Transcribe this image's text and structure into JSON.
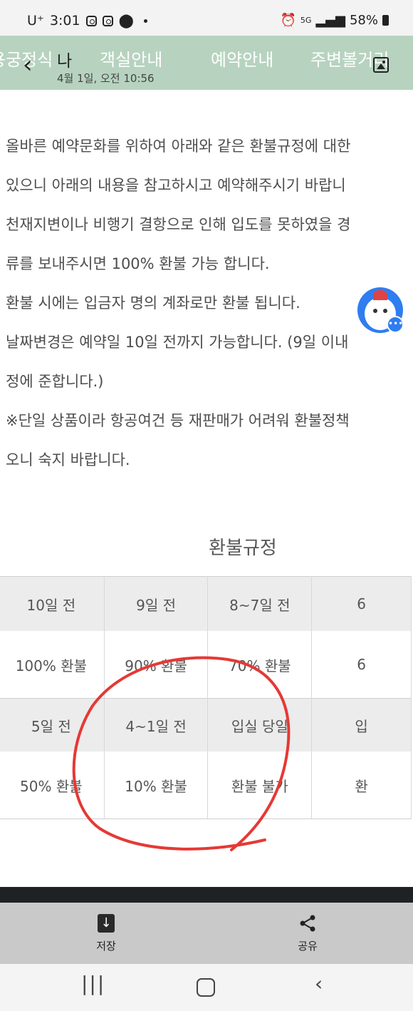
{
  "status_bar": {
    "carrier": "U⁺",
    "time": "3:01",
    "network": "5G",
    "battery": "58%"
  },
  "header": {
    "nav_items": [
      "용궁정식",
      "객실안내",
      "예약안내",
      "주변볼거리"
    ],
    "overlay_title": "나",
    "overlay_date": "4월 1일, 오전 10:56"
  },
  "body_text": {
    "lines": [
      "올바른 예약문화를 위하여 아래와 같은 환불규정에 대한",
      "있으니 아래의 내용을 참고하시고 예약해주시기 바랍니",
      "천재지변이나 비행기 결항으로 인해 입도를 못하였을 경",
      "류를 보내주시면 100% 환불 가능 합니다.",
      "환불 시에는 입금자 명의 계좌로만 환불 됩니다.",
      "날짜변경은 예약일 10일 전까지 가능합니다. (9일 이내",
      "정에 준합니다.)",
      "※단일 상품이라 항공여건 등 재판매가 어려워 환불정책",
      "오니 숙지 바랍니다."
    ]
  },
  "refund_table": {
    "title": "환불규정",
    "row1_headers": [
      "10일 전",
      "9일 전",
      "8~7일 전",
      "6"
    ],
    "row1_values": [
      "100% 환불",
      "90% 환불",
      "70% 환불",
      "6"
    ],
    "row2_headers": [
      "5일 전",
      "4~1일 전",
      "입실 당일",
      "입"
    ],
    "row2_values": [
      "50% 환불",
      "10% 환불",
      "환불 불가",
      "환"
    ]
  },
  "action_bar": {
    "save_label": "저장",
    "share_label": "공유"
  },
  "colors": {
    "header_bg": "#b7d3bf",
    "annotation_red": "#e53935",
    "chatbot_blue": "#2f7df0"
  }
}
